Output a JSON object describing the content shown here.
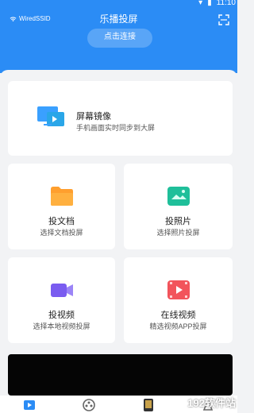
{
  "status_bar": {
    "time": "11:10"
  },
  "header": {
    "ssid": "WiredSSID",
    "title": "乐播投屏",
    "connect_label": "点击连接"
  },
  "mirror": {
    "title": "屏幕镜像",
    "subtitle": "手机画面实时同步到大屏"
  },
  "tiles": [
    {
      "title": "投文档",
      "subtitle": "选择文档投屏"
    },
    {
      "title": "投照片",
      "subtitle": "选择照片投屏"
    },
    {
      "title": "投视频",
      "subtitle": "选择本地视频投屏"
    },
    {
      "title": "在线视频",
      "subtitle": "精选视频APP投屏"
    }
  ],
  "watermark": "192软件站",
  "colors": {
    "accent": "#2b8cf5"
  }
}
